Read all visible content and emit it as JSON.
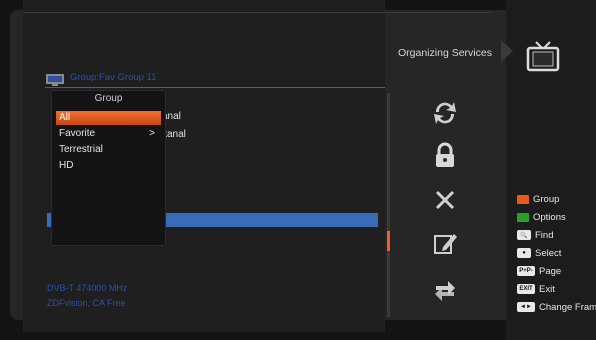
{
  "header": {
    "section_title": "Organizing Services",
    "group_label": "Group:Fav Group 11"
  },
  "group_menu": {
    "title": "Group",
    "items": [
      {
        "label": "All",
        "selected": true
      },
      {
        "label": "Favorite",
        "has_submenu": true,
        "submenu_glyph": ">"
      },
      {
        "label": "Terrestrial"
      },
      {
        "label": "HD"
      }
    ]
  },
  "channel_list": {
    "visible_fragments": [
      "anal",
      "kanal"
    ]
  },
  "info": {
    "line1": "DVB-T 474000 MHz",
    "line2": "ZDFvision, CA Free"
  },
  "tools": [
    "sync-icon",
    "lock-icon",
    "delete-icon",
    "edit-icon",
    "move-icon"
  ],
  "legend": [
    {
      "key": "red",
      "key_color": "#e85a1a",
      "label": "Group"
    },
    {
      "key": "green",
      "key_color": "#29a02a",
      "label": "Options"
    },
    {
      "key": "find",
      "key_badge": "🔍",
      "label": "Find"
    },
    {
      "key": "ok",
      "key_badge": "●",
      "label": "Select"
    },
    {
      "key": "page",
      "key_badge": "P+P-",
      "label": "Page"
    },
    {
      "key": "exit",
      "key_badge": "EXIT",
      "label": "Exit"
    },
    {
      "key": "frame",
      "key_badge": "◄►",
      "label": "Change Fram"
    }
  ],
  "colors": {
    "accent_orange": "#f06020",
    "selection_blue": "#3a6bb8",
    "info_blue": "#2a4fae"
  }
}
